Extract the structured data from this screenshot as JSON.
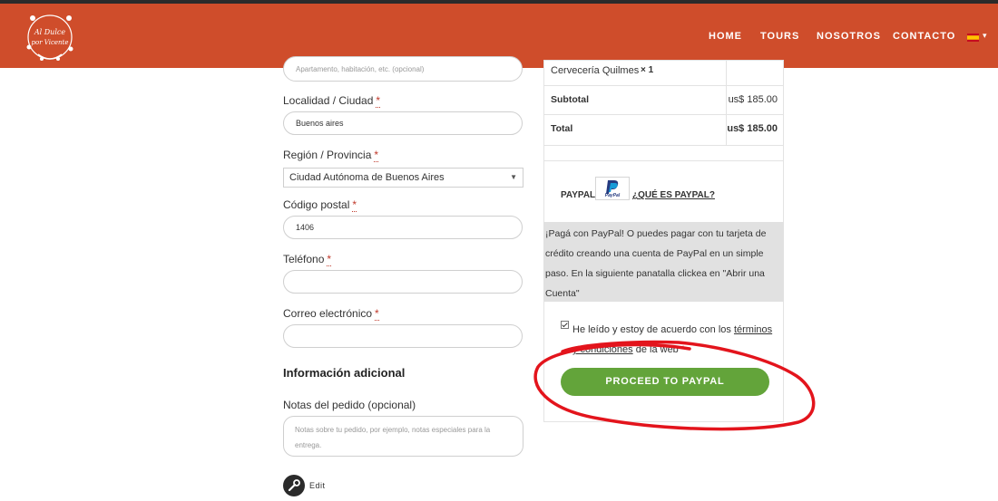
{
  "header": {
    "logo_text": [
      "Al Dulce",
      "por Vicente"
    ],
    "nav": [
      "HOME",
      "TOURS",
      "NOSOTROS",
      "CONTACTO"
    ],
    "language": "es",
    "colors": {
      "header_bg": "#cf4d2b",
      "accent_green": "#63a43a"
    }
  },
  "form": {
    "apartment_placeholder": "Apartamento, habitación, etc. (opcional)",
    "city_label": "Localidad / Ciudad",
    "city_value": "Buenos aires",
    "region_label": "Región / Provincia",
    "region_value": "Ciudad Autónoma de Buenos Aires",
    "postcode_label": "Código postal",
    "postcode_value": "1406",
    "phone_label": "Teléfono",
    "phone_value": "",
    "email_label": "Correo electrónico",
    "email_value": "",
    "required_mark": "*",
    "additional_heading": "Información adicional",
    "notes_label": "Notas del pedido (opcional)",
    "notes_placeholder": "Notas sobre tu pedido, por ejemplo, notas especiales para la entrega.",
    "edit_label": "Edit"
  },
  "order": {
    "item_name": "Cervecería Quilmes",
    "item_qty": "× 1",
    "subtotal_label": "Subtotal",
    "subtotal_value": "us$ 185.00",
    "total_label": "Total",
    "total_value": "us$ 185.00"
  },
  "payment": {
    "method_label": "PAYPAL",
    "what_is_paypal": "¿QUÉ ES PAYPAL?",
    "logo_text": "PayPal",
    "description": "¡Pagá con PayPal! O puedes pagar con tu tarjeta de crédito creando una cuenta de PayPal en un simple paso. En la siguiente panatalla clickea en \"Abrir una Cuenta\"",
    "terms_prefix": "He leído y estoy de acuerdo con los ",
    "terms_link": "términos y condiciones",
    "terms_suffix": " de la web ",
    "terms_required": "*",
    "terms_checked": true,
    "proceed_button": "PROCEED TO PAYPAL"
  }
}
